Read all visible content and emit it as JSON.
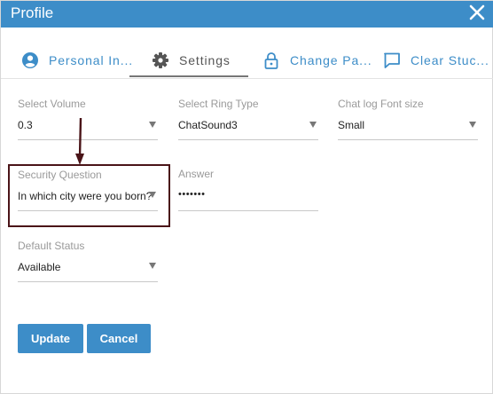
{
  "window": {
    "title": "Profile",
    "close_icon": "close-icon"
  },
  "tabs": [
    {
      "label": "Personal In...",
      "icon": "user-circle-icon",
      "active": false
    },
    {
      "label": "Settings",
      "icon": "gear-icon",
      "active": true
    },
    {
      "label": "Change Pa...",
      "icon": "lock-icon",
      "active": false
    },
    {
      "label": "Clear Stuc...",
      "icon": "chat-icon",
      "active": false
    }
  ],
  "settings": {
    "volume": {
      "label": "Select Volume",
      "value": "0.3"
    },
    "ring_type": {
      "label": "Select Ring Type",
      "value": "ChatSound3"
    },
    "font_size": {
      "label": "Chat log Font size",
      "value": "Small"
    },
    "security_question": {
      "label": "Security Question",
      "value": "In which city were you born?"
    },
    "answer": {
      "label": "Answer",
      "value": "•••••••"
    },
    "default_status": {
      "label": "Default Status",
      "value": "Available"
    }
  },
  "buttons": {
    "update": "Update",
    "cancel": "Cancel"
  },
  "colors": {
    "accent": "#3d8dc8",
    "annotation": "#4a1418"
  }
}
